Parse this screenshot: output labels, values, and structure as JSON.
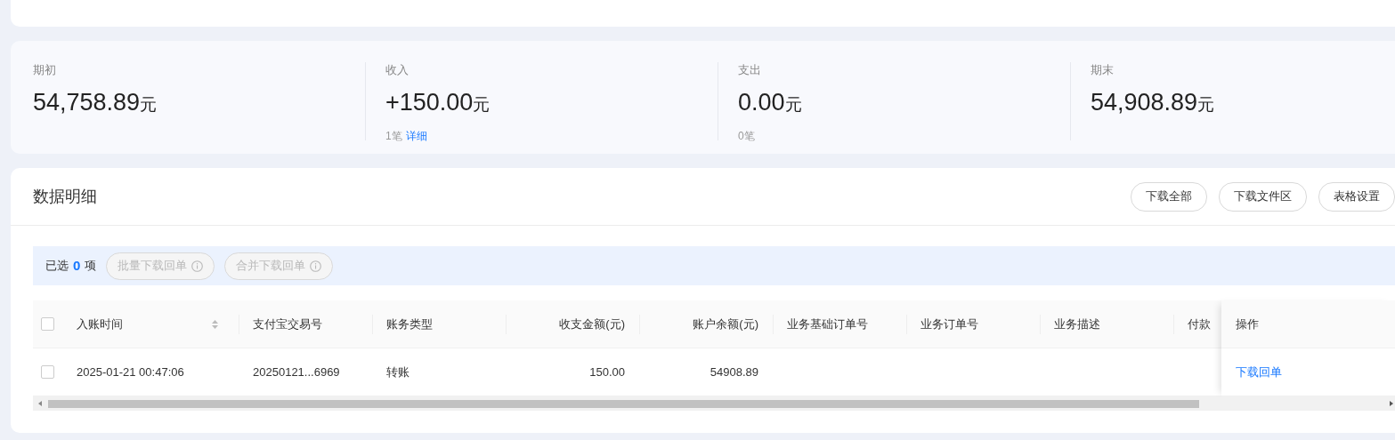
{
  "summary": [
    {
      "label": "期初",
      "amount": "54,758.89",
      "unit": "元"
    },
    {
      "label": "收入",
      "amount": "+150.00",
      "unit": "元",
      "count": "1笔",
      "link": "详细"
    },
    {
      "label": "支出",
      "amount": "0.00",
      "unit": "元",
      "count": "0笔"
    },
    {
      "label": "期末",
      "amount": "54,908.89",
      "unit": "元"
    }
  ],
  "details": {
    "title": "数据明细",
    "buttons": [
      "下载全部",
      "下载文件区",
      "表格设置"
    ],
    "selection": {
      "prefix": "已选",
      "count": "0",
      "suffix": "项",
      "actions": [
        {
          "label": "批量下载回单",
          "disabled": true
        },
        {
          "label": "合并下载回单",
          "disabled": true
        }
      ]
    },
    "table": {
      "all_checked": false,
      "columns": [
        {
          "label": "入账时间",
          "kind": "text",
          "sortable": true
        },
        {
          "label": "支付宝交易号",
          "kind": "text",
          "sortable": false
        },
        {
          "label": "账务类型",
          "kind": "text",
          "sortable": false
        },
        {
          "label": "收支金额(元)",
          "kind": "amount",
          "sortable": false
        },
        {
          "label": "账户余额(元)",
          "kind": "amount",
          "sortable": false
        },
        {
          "label": "业务基础订单号",
          "kind": "text",
          "sortable": false
        },
        {
          "label": "业务订单号",
          "kind": "text",
          "sortable": false
        },
        {
          "label": "业务描述",
          "kind": "text",
          "sortable": false
        },
        {
          "label": "付款",
          "kind": "text",
          "sortable": false
        }
      ],
      "action_column": "操作",
      "rows": [
        {
          "selected": false,
          "cells": [
            "2025-01-21 00:47:06",
            "20250121...6969",
            "转账",
            "150.00",
            "54908.89",
            "",
            "",
            "",
            ""
          ],
          "action": "下载回单"
        }
      ]
    }
  }
}
